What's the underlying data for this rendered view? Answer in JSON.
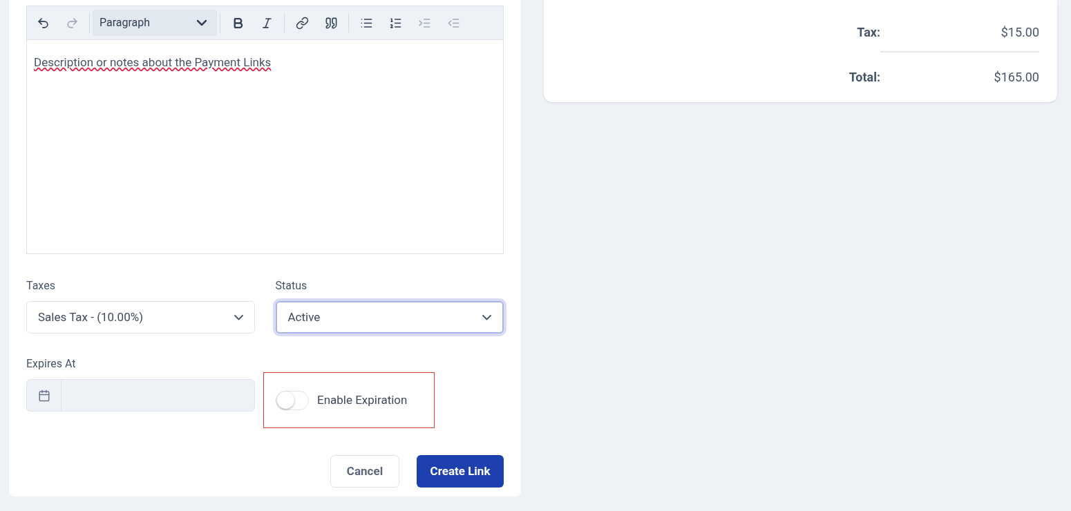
{
  "editor": {
    "toolbar": [
      {
        "kind": "undo",
        "disabled": false
      },
      {
        "kind": "redo",
        "disabled": true
      },
      {
        "kind": "divider"
      },
      {
        "kind": "block-format",
        "value": "Paragraph"
      },
      {
        "kind": "divider"
      },
      {
        "kind": "bold",
        "disabled": false
      },
      {
        "kind": "italic",
        "disabled": false
      },
      {
        "kind": "divider"
      },
      {
        "kind": "link",
        "disabled": false
      },
      {
        "kind": "quote",
        "disabled": false
      },
      {
        "kind": "divider"
      },
      {
        "kind": "bullet-list",
        "disabled": false
      },
      {
        "kind": "numbered-list",
        "disabled": false
      },
      {
        "kind": "indent",
        "disabled": true
      },
      {
        "kind": "outdent",
        "disabled": true
      }
    ],
    "content": "Description or notes about the Payment Links"
  },
  "taxes": {
    "label": "Taxes",
    "value": "Sales Tax - (10.00%)",
    "focused": false
  },
  "status": {
    "label": "Status",
    "value": "Active",
    "focused": true
  },
  "expires_at": {
    "label": "Expires At"
  },
  "expiration_toggle": {
    "label": "Enable Expiration",
    "on": false,
    "highlighted": true
  },
  "buttons": [
    {
      "kind": "secondary",
      "label": "Cancel"
    },
    {
      "kind": "primary",
      "label": "Create Link"
    }
  ],
  "summary": [
    {
      "kind": "line",
      "label": "Tax:",
      "value": "$15.00"
    },
    {
      "kind": "total",
      "label": "Total:",
      "value": "$165.00"
    }
  ]
}
